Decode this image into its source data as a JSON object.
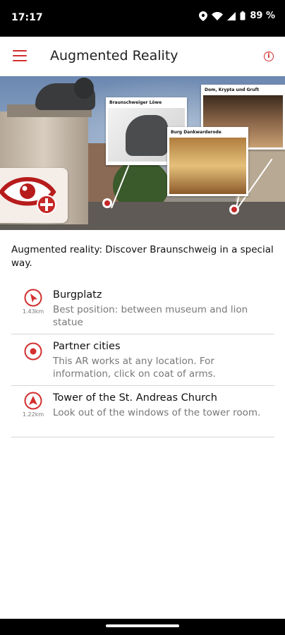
{
  "status": {
    "time": "17:17",
    "battery": "89 %"
  },
  "app_bar": {
    "title": "Augmented Reality"
  },
  "hero": {
    "cards": [
      {
        "label": "Braunschweiger Löwe"
      },
      {
        "label": "Dom, Krypta und Gruft"
      },
      {
        "label": "Burg Dankwarderode"
      }
    ]
  },
  "intro": "Augmented reality: Discover Braunschweig in a special way.",
  "items": [
    {
      "title": "Burgplatz",
      "subtitle": "Best position: between museum and lion statue",
      "distance": "1.43km",
      "icon": "navigation-arrow-icon"
    },
    {
      "title": "Partner cities",
      "subtitle": "This AR works at any location. For information, click on coat of arms.",
      "distance": "",
      "icon": "location-target-icon"
    },
    {
      "title": "Tower of the St. Andreas Church",
      "subtitle": "Look out of the windows of the tower room.",
      "distance": "1.22km",
      "icon": "navigation-arrow-icon"
    }
  ],
  "colors": {
    "accent": "#d32f2f",
    "text": "#111111",
    "secondary_text": "#777777",
    "divider": "#d6d6d6"
  }
}
